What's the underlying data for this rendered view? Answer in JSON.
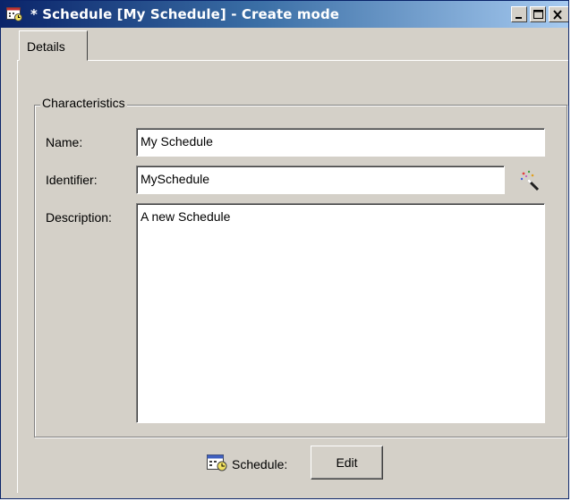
{
  "window": {
    "title": "* Schedule [My Schedule] - Create mode",
    "buttons": {
      "minimize": "_",
      "maximize": "□",
      "close": "X"
    }
  },
  "tabs": [
    {
      "label": "Details",
      "selected": true
    }
  ],
  "characteristics": {
    "legend": "Characteristics",
    "name_label": "Name:",
    "name_value": "My Schedule",
    "identifier_label": "Identifier:",
    "identifier_value": "MySchedule",
    "description_label": "Description:",
    "description_value": "A new Schedule"
  },
  "footer": {
    "schedule_label": "Schedule:",
    "edit_button": "Edit"
  },
  "icons": {
    "title": "schedule-calendar-icon",
    "wand": "magic-wand-icon",
    "schedule": "schedule-calendar-icon"
  },
  "colors": {
    "titlebar_start": "#0a246a",
    "titlebar_end": "#a6caf0",
    "dialog_bg": "#d4d0c8"
  }
}
